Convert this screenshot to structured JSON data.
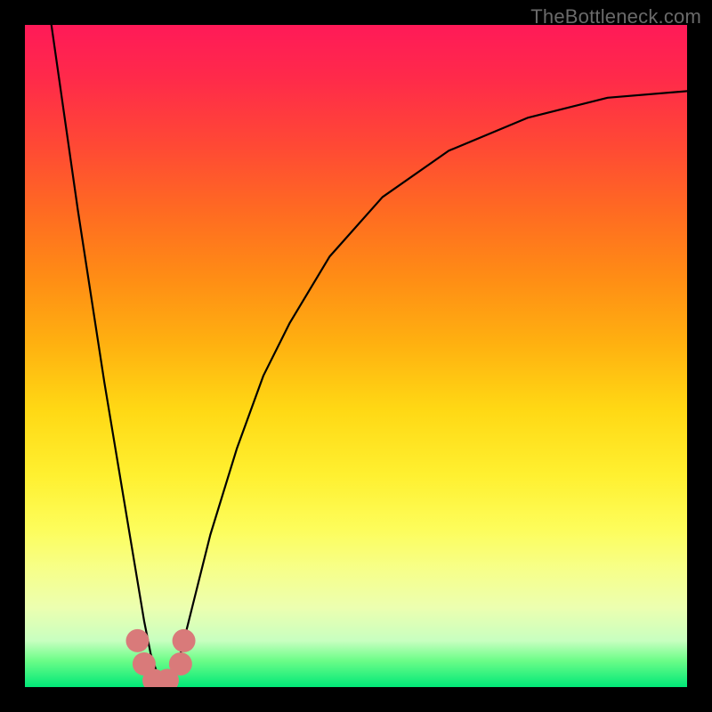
{
  "watermark": "TheBottleneck.com",
  "chart_data": {
    "type": "line",
    "title": "",
    "xlabel": "",
    "ylabel": "",
    "xlim": [
      0,
      100
    ],
    "ylim": [
      0,
      100
    ],
    "series": [
      {
        "name": "bottleneck-curve",
        "x": [
          4,
          6,
          8,
          10,
          12,
          14,
          16,
          17,
          18,
          19,
          20,
          21,
          22,
          23,
          24,
          26,
          28,
          32,
          36,
          40,
          46,
          54,
          64,
          76,
          88,
          100
        ],
        "y": [
          100,
          86,
          72,
          59,
          46,
          34,
          22,
          16,
          10,
          5,
          2,
          0.5,
          0.5,
          3,
          7,
          15,
          23,
          36,
          47,
          55,
          65,
          74,
          81,
          86,
          89,
          90
        ]
      }
    ],
    "markers": [
      {
        "name": "marker-left-1",
        "x": 17.0,
        "y": 7.0
      },
      {
        "name": "marker-left-2",
        "x": 18.0,
        "y": 3.5
      },
      {
        "name": "marker-bottom-1",
        "x": 19.5,
        "y": 1.0
      },
      {
        "name": "marker-bottom-2",
        "x": 21.5,
        "y": 1.0
      },
      {
        "name": "marker-right-1",
        "x": 23.5,
        "y": 3.5
      },
      {
        "name": "marker-right-2",
        "x": 24.0,
        "y": 7.0
      }
    ],
    "marker_color": "#d97a7a",
    "curve_color": "#000000"
  }
}
